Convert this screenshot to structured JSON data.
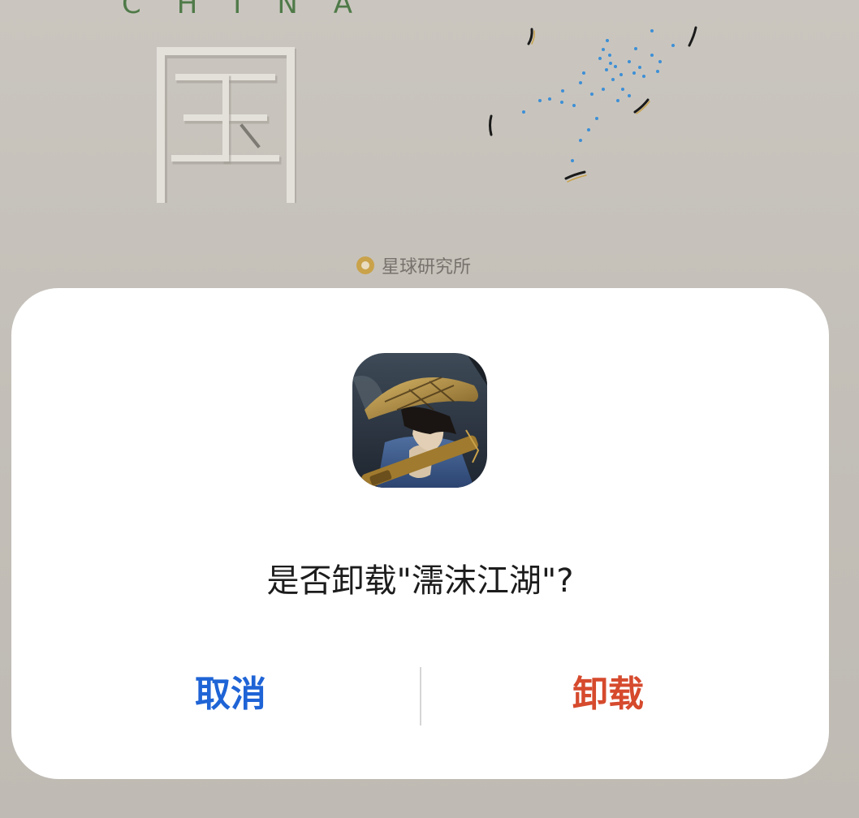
{
  "wallpaper": {
    "top_text": "CHINA",
    "credit_label": "星球研究所",
    "colors": {
      "background": "#c4c0b9",
      "china_text": "#4f7a48",
      "star_dots": "#3d8fd6",
      "credit_icon": "#c9a24a"
    }
  },
  "dialog": {
    "app_icon": "swordsman-game-app-icon",
    "message": "是否卸载\"濡沫江湖\"?",
    "cancel_label": "取消",
    "uninstall_label": "卸载",
    "colors": {
      "cancel": "#1f64d6",
      "uninstall": "#d64a2d",
      "background": "#ffffff"
    }
  }
}
